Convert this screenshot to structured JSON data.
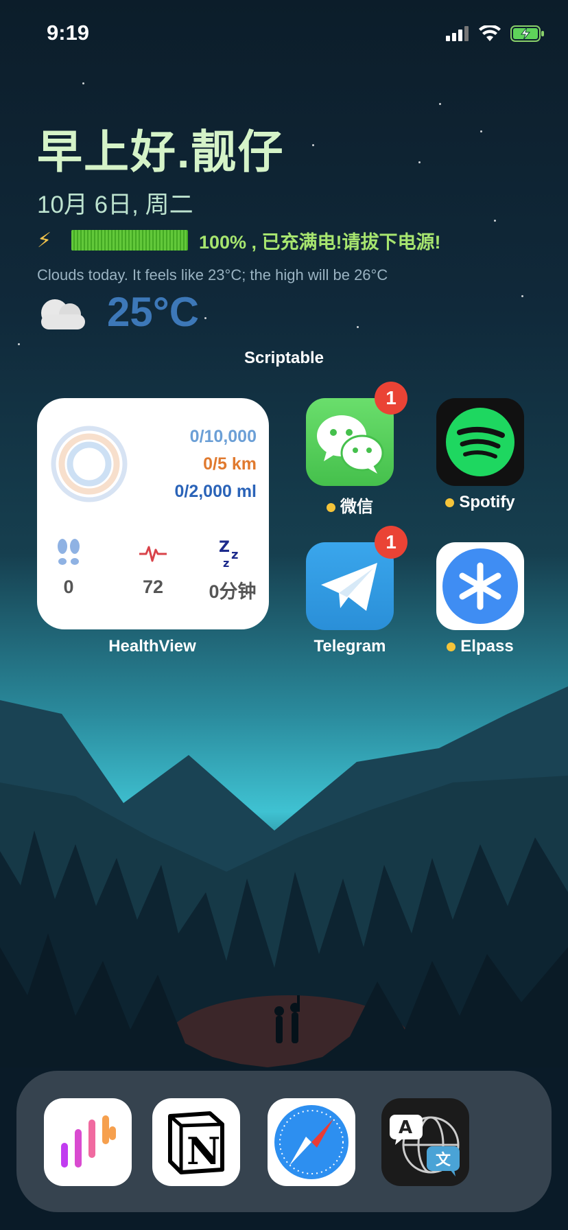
{
  "status_bar": {
    "time": "9:19"
  },
  "widget": {
    "greeting": "早上好.靓仔",
    "date": "10月 6日, 周二",
    "battery_icon": "lightning-icon",
    "battery_text": "100% , 已充满电!请拔下电源!",
    "weather_summary": "Clouds today. It feels like 23°C; the high will be 26°C",
    "temperature": "25°C",
    "name": "Scriptable"
  },
  "health_widget": {
    "steps_goal": "0/10,000",
    "distance": "0/5 km",
    "water": "0/2,000 ml",
    "stats": [
      {
        "icon": "footprints-icon",
        "value": "0"
      },
      {
        "icon": "heartbeat-icon",
        "value": "72"
      },
      {
        "icon": "sleep-icon",
        "value": "0分钟"
      }
    ],
    "label": "HealthView",
    "colors": {
      "steps": "#6b9fd6",
      "distance": "#e07a2f",
      "water": "#2a63b8"
    }
  },
  "apps": [
    {
      "name": "微信",
      "badge": "1",
      "dot": true
    },
    {
      "name": "Spotify",
      "dot": true
    },
    {
      "name": "Telegram",
      "badge": "1"
    },
    {
      "name": "Elpass",
      "dot": true
    }
  ],
  "dock": [
    {
      "icon": "audio-bars-icon"
    },
    {
      "icon": "notion-icon"
    },
    {
      "icon": "safari-compass-icon"
    },
    {
      "icon": "translate-icon"
    }
  ]
}
